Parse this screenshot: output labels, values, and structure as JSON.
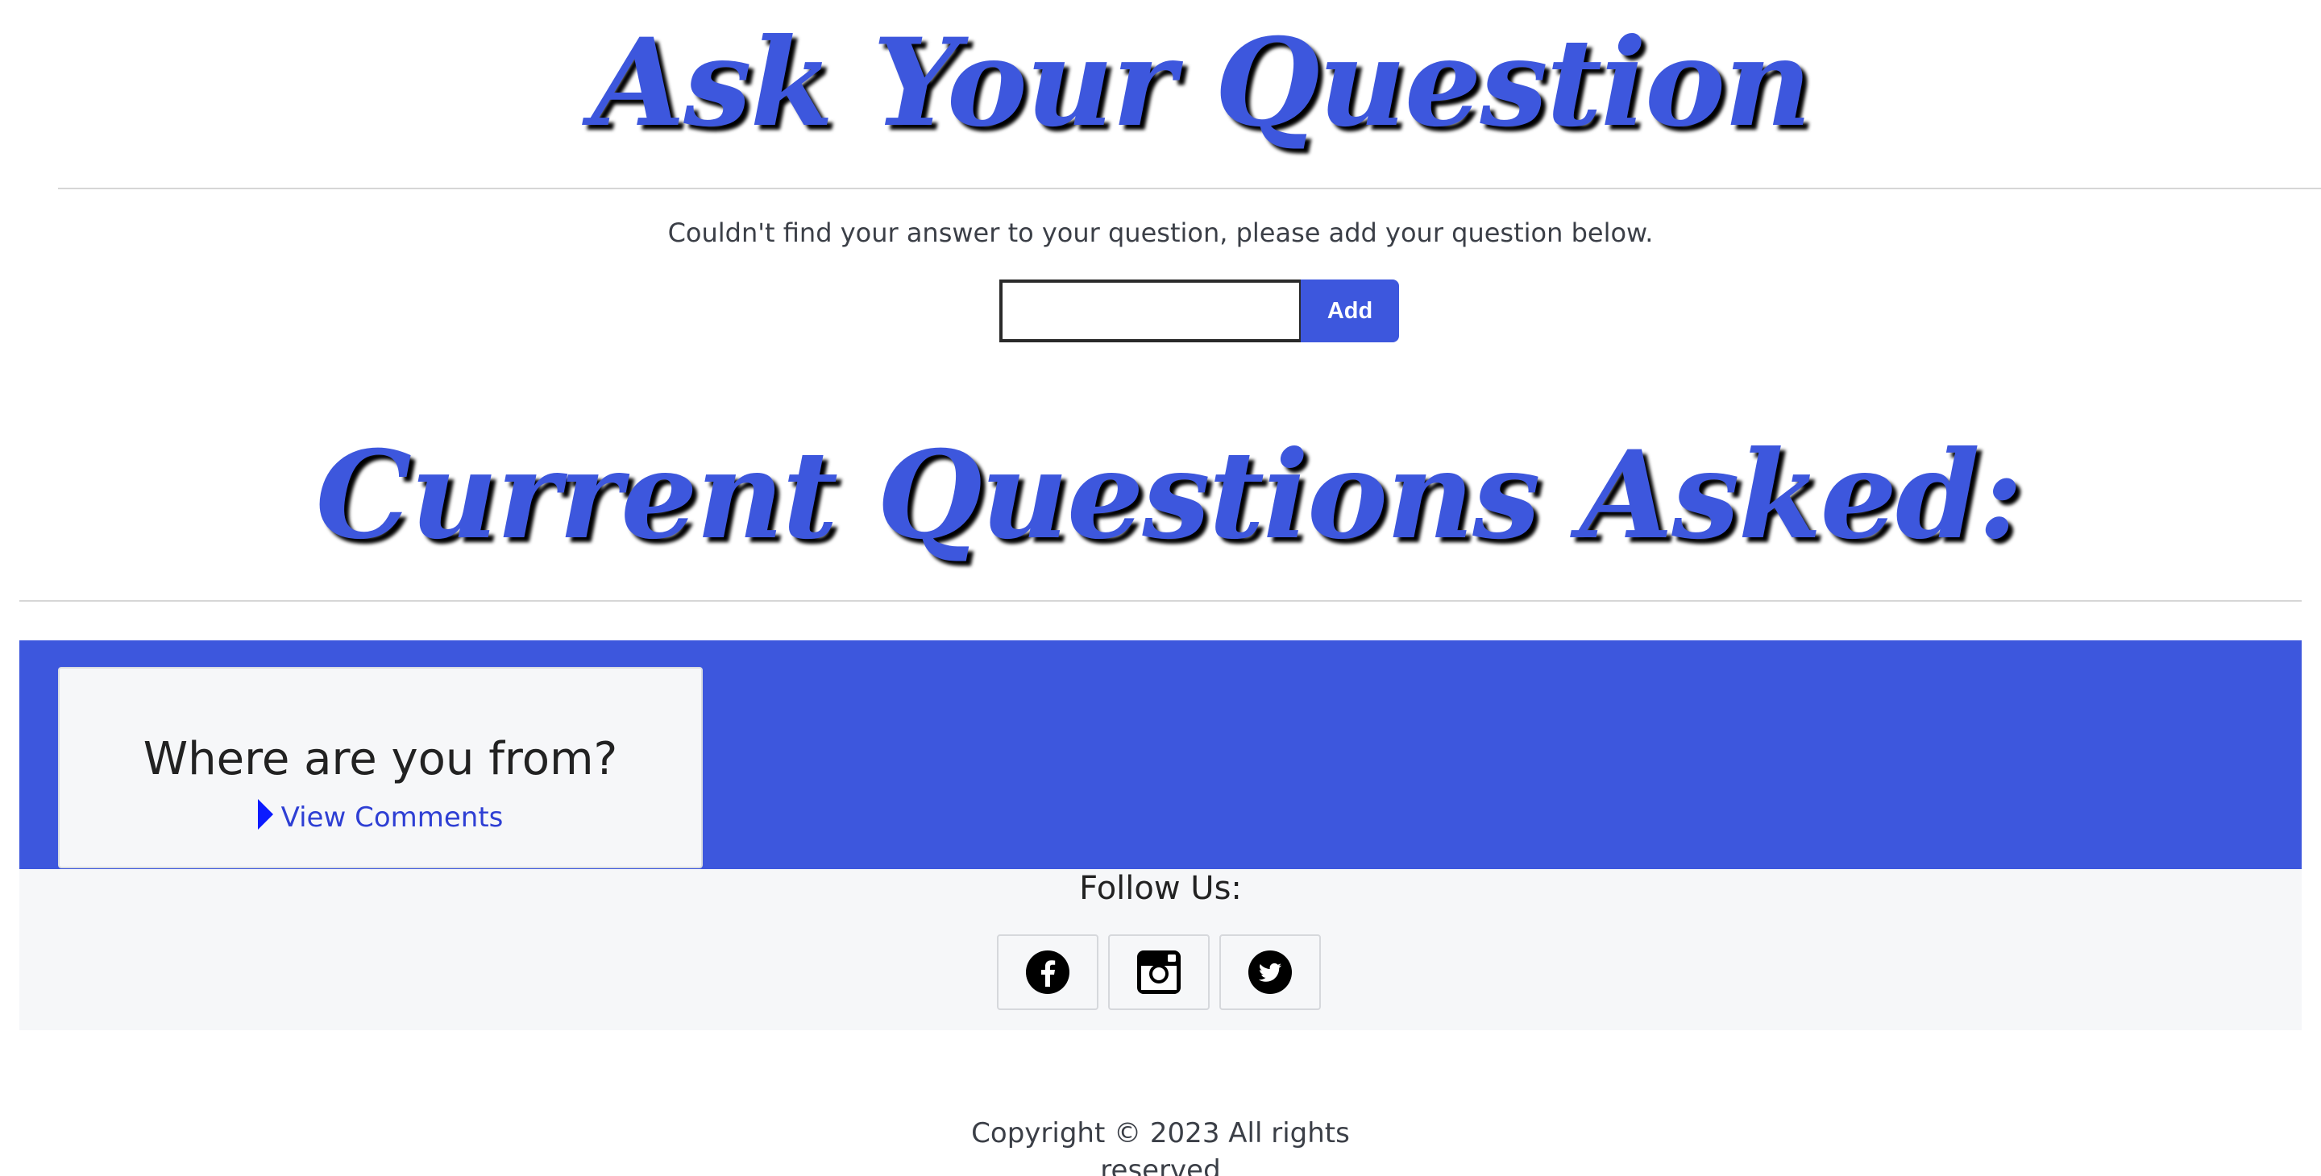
{
  "header": {
    "title": "Ask Your Question",
    "prompt": "Couldn't find your answer to your question, please add your question below."
  },
  "form": {
    "input_value": "",
    "input_placeholder": "",
    "add_label": "Add"
  },
  "questions_section": {
    "title": "Current Questions Asked:",
    "questions": [
      {
        "text": "Where are you from?",
        "link_label": "View Comments"
      }
    ]
  },
  "footer": {
    "follow_label": "Follow Us:",
    "social": [
      {
        "icon": "facebook-icon"
      },
      {
        "icon": "instagram-icon"
      },
      {
        "icon": "twitter-icon"
      }
    ],
    "copyright_line1": "Copyright © 2023 All rights",
    "copyright_line2": "reserved"
  },
  "colors": {
    "accent": "#3d57dd",
    "footer_bg": "#f6f7f9",
    "text": "#3b3f47"
  }
}
